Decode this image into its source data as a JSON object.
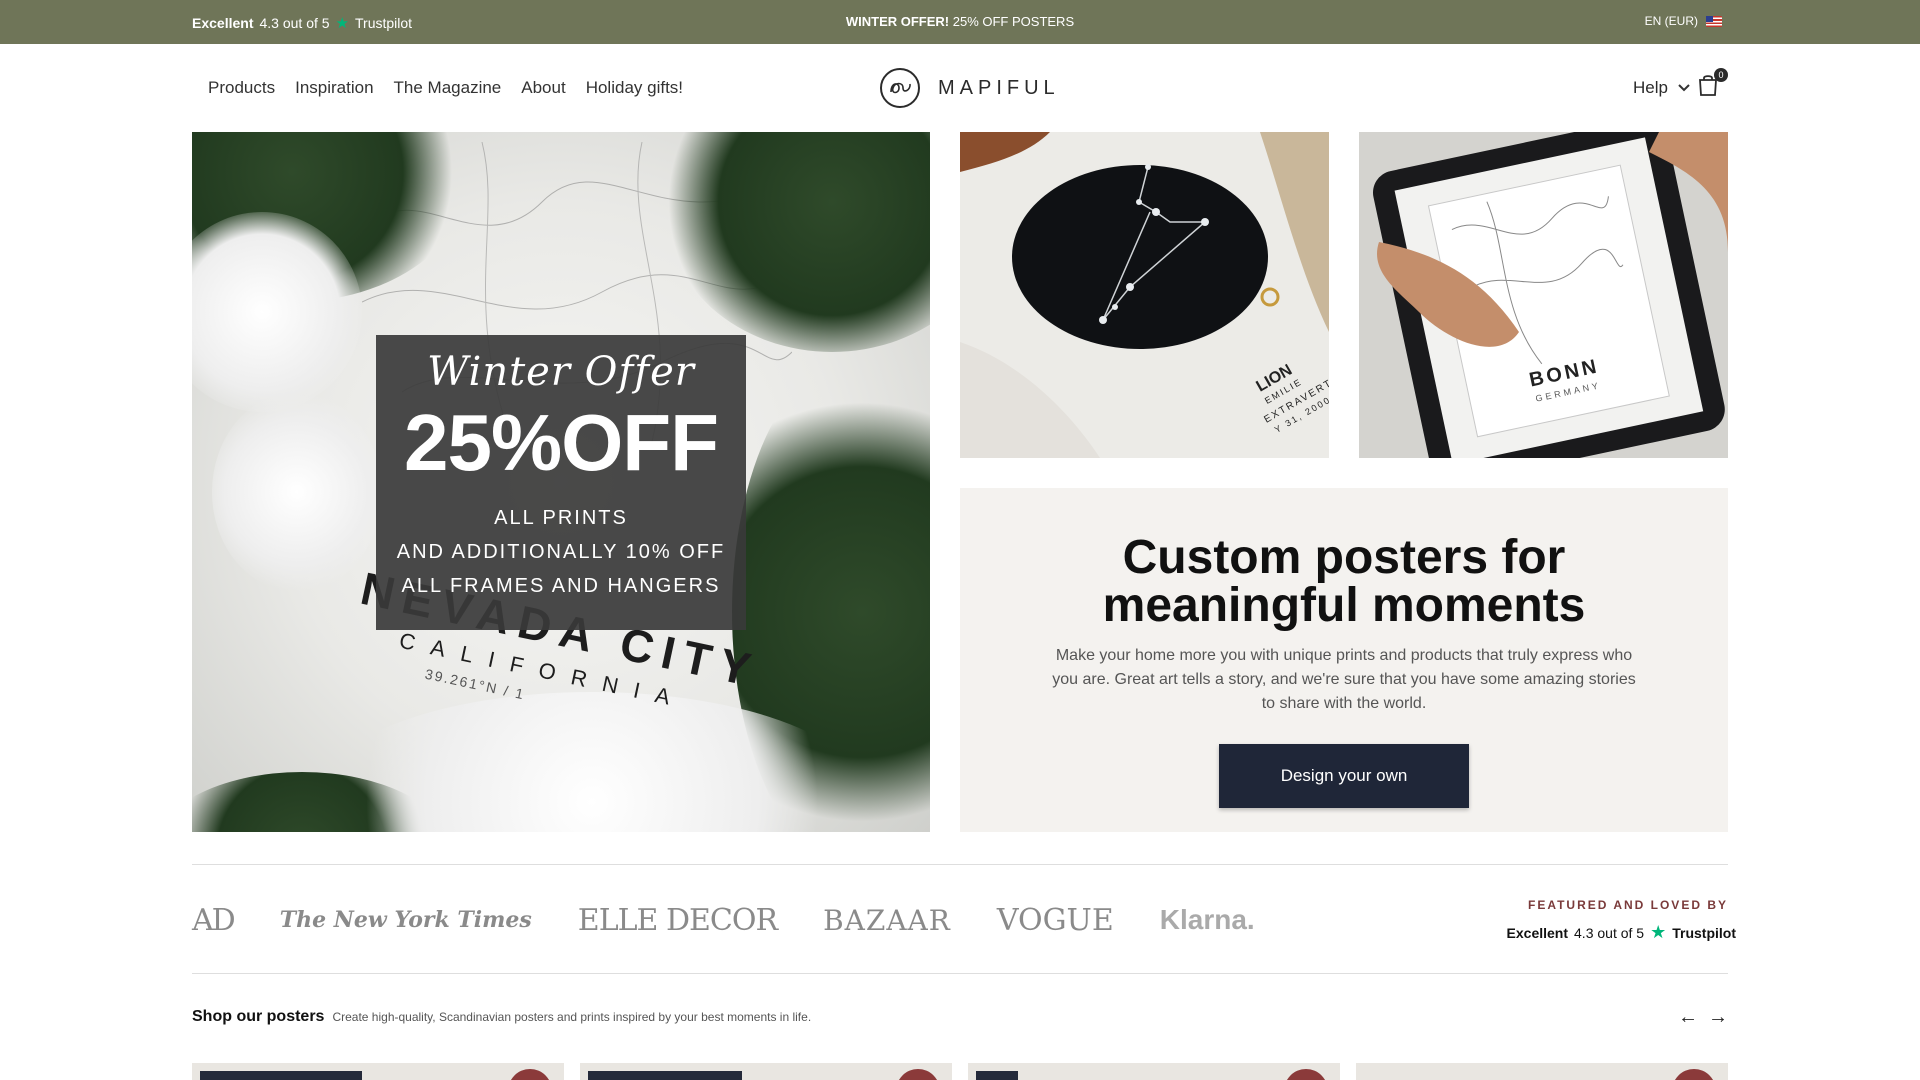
{
  "topbar": {
    "trustpilot_rating": "Excellent",
    "trustpilot_score": "4.3 out of 5",
    "trustpilot_name": "Trustpilot",
    "offer_bold": "WINTER OFFER!",
    "offer_text": " 25% OFF POSTERS",
    "language": "EN (EUR)"
  },
  "nav": {
    "items": [
      {
        "label": "Products"
      },
      {
        "label": "Inspiration"
      },
      {
        "label": "The Magazine"
      },
      {
        "label": "About"
      },
      {
        "label": "Holiday gifts!"
      }
    ],
    "logo_text": "MAPIFUL",
    "help": "Help",
    "cart_count": "0"
  },
  "hero": {
    "script": "Winter Offer",
    "big": "25%OFF",
    "line1": "ALL PRINTS",
    "line2": "AND ADDITIONALLY 10% OFF",
    "line3": "ALL FRAMES AND HANGERS",
    "poster_city": "NEVADA CITY",
    "poster_state": "CALIFORNIA",
    "poster_coords": "39.261°N / 1",
    "tile1": {
      "title": "LION",
      "name": "EMILIE",
      "word": "EXTRAVERTIE",
      "date": "Y 31, 2000"
    },
    "tile2": {
      "city": "BONN",
      "country": "GERMANY"
    }
  },
  "custom": {
    "title_line1": "Custom posters for",
    "title_line2": "meaningful moments",
    "description": "Make your home more you with unique prints and products that truly express who you are. Great art tells a story, and we're sure that you have some amazing stories to share with the world.",
    "button": "Design your own"
  },
  "press": {
    "logos": [
      "AD",
      "The New York Times",
      "ELLE DECOR",
      "BAZAAR",
      "VOGUE",
      "Klarna."
    ],
    "featured": "FEATURED AND LOVED BY",
    "rating": "Excellent",
    "score": "4.3 out of 5",
    "trustpilot": "Trustpilot"
  },
  "shop": {
    "title": "Shop our posters",
    "description": "Create high-quality, Scandinavian posters and prints inspired by your best moments in life.",
    "prev": "←",
    "next": "→"
  },
  "colors": {
    "topbar_bg": "#6f7558",
    "button_bg": "#1f2638",
    "panel_bg": "#f4f2ef",
    "trustpilot_star": "#00b67a"
  }
}
